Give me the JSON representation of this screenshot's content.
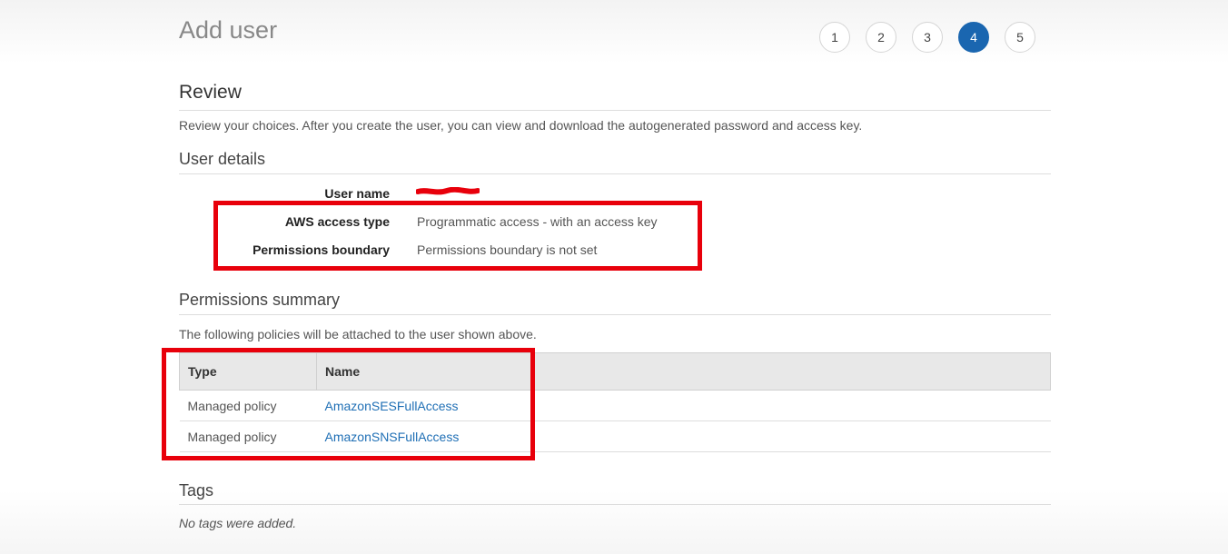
{
  "page": {
    "title": "Add user"
  },
  "steps": [
    "1",
    "2",
    "3",
    "4",
    "5"
  ],
  "active_step": "4",
  "review": {
    "heading": "Review",
    "description": "Review your choices. After you create the user, you can view and download the autogenerated password and access key."
  },
  "user_details": {
    "heading": "User details",
    "user_name_label": "User name",
    "access_type_label": "AWS access type",
    "access_type_value": "Programmatic access - with an access key",
    "boundary_label": "Permissions boundary",
    "boundary_value": "Permissions boundary is not set"
  },
  "permissions_summary": {
    "heading": "Permissions summary",
    "description": "The following policies will be attached to the user shown above.",
    "columns": [
      "Type",
      "Name"
    ],
    "rows": [
      {
        "type": "Managed policy",
        "name": "AmazonSESFullAccess"
      },
      {
        "type": "Managed policy",
        "name": "AmazonSNSFullAccess"
      }
    ]
  },
  "tags": {
    "heading": "Tags",
    "empty_text": "No tags were added."
  },
  "colors": {
    "accent": "#1a66b0",
    "highlight": "#e8000b",
    "link": "#1f6fb5"
  }
}
